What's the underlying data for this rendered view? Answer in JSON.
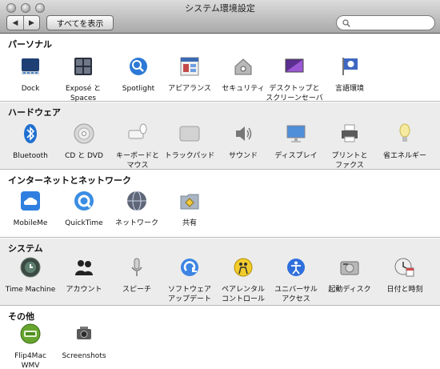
{
  "window": {
    "title": "システム環境設定",
    "toolbar": {
      "show_all_label": "すべてを表示",
      "back_label": "◀",
      "forward_label": "▶"
    },
    "search": {
      "value": ""
    }
  },
  "sections": [
    {
      "title": "パーソナル",
      "items": [
        {
          "label": "Dock",
          "icon": "dock-icon"
        },
        {
          "label": "Exposé と\nSpaces",
          "icon": "expose-spaces-icon"
        },
        {
          "label": "Spotlight",
          "icon": "spotlight-icon"
        },
        {
          "label": "アピアランス",
          "icon": "appearance-icon"
        },
        {
          "label": "セキュリティ",
          "icon": "security-icon"
        },
        {
          "label": "デスクトップと\nスクリーンセーバ",
          "icon": "desktop-screensaver-icon"
        },
        {
          "label": "言語環境",
          "icon": "language-icon"
        }
      ]
    },
    {
      "title": "ハードウェア",
      "items": [
        {
          "label": "Bluetooth",
          "icon": "bluetooth-icon"
        },
        {
          "label": "CD と DVD",
          "icon": "cd-dvd-icon"
        },
        {
          "label": "キーボードと\nマウス",
          "icon": "keyboard-mouse-icon"
        },
        {
          "label": "トラックパッド",
          "icon": "trackpad-icon"
        },
        {
          "label": "サウンド",
          "icon": "sound-icon"
        },
        {
          "label": "ディスプレイ",
          "icon": "display-icon"
        },
        {
          "label": "プリントと\nファクス",
          "icon": "print-fax-icon"
        },
        {
          "label": "省エネルギー",
          "icon": "energy-saver-icon"
        }
      ]
    },
    {
      "title": "インターネットとネットワーク",
      "items": [
        {
          "label": "MobileMe",
          "icon": "mobileme-icon"
        },
        {
          "label": "QuickTime",
          "icon": "quicktime-icon"
        },
        {
          "label": "ネットワーク",
          "icon": "network-icon"
        },
        {
          "label": "共有",
          "icon": "sharing-icon"
        }
      ]
    },
    {
      "title": "システム",
      "items": [
        {
          "label": "Time Machine",
          "icon": "time-machine-icon"
        },
        {
          "label": "アカウント",
          "icon": "accounts-icon"
        },
        {
          "label": "スピーチ",
          "icon": "speech-icon"
        },
        {
          "label": "ソフトウェア\nアップデート",
          "icon": "software-update-icon"
        },
        {
          "label": "ペアレンタル\nコントロール",
          "icon": "parental-controls-icon"
        },
        {
          "label": "ユニバーサル\nアクセス",
          "icon": "universal-access-icon"
        },
        {
          "label": "起動ディスク",
          "icon": "startup-disk-icon"
        },
        {
          "label": "日付と時刻",
          "icon": "date-time-icon"
        }
      ]
    },
    {
      "title": "その他",
      "items": [
        {
          "label": "Flip4Mac\nWMV",
          "icon": "flip4mac-icon"
        },
        {
          "label": "Screenshots",
          "icon": "screenshots-icon"
        }
      ]
    }
  ]
}
